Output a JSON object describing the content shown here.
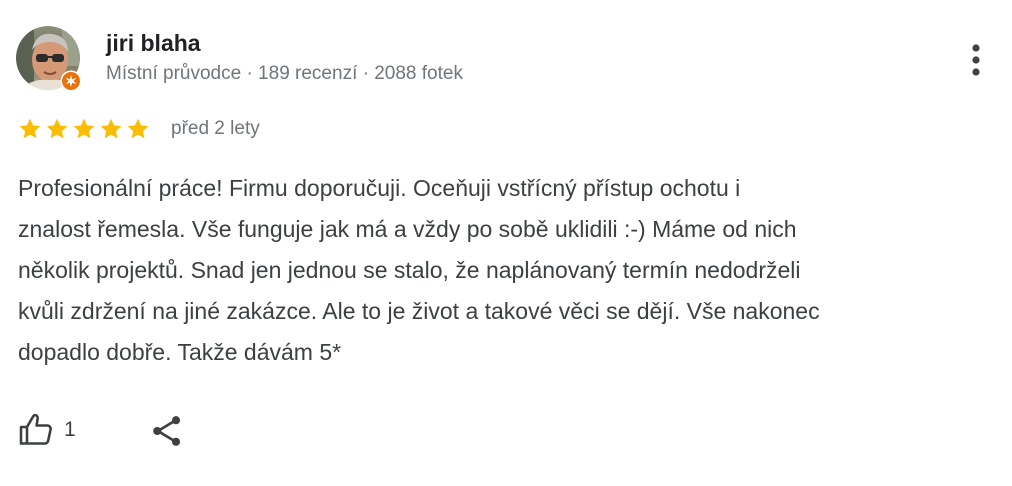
{
  "review": {
    "author": {
      "name": "jiri blaha",
      "meta": "Místní průvodce · 189 recenzí · 2088 fotek",
      "avatar_icon": "user-avatar",
      "badge_icon": "local-guide-badge-icon",
      "badge_color": "#e8710a"
    },
    "rating": {
      "stars": 5,
      "max": 5,
      "star_color": "#fbbc04"
    },
    "date": "před 2 lety",
    "text": "Profesionální práce! Firmu doporučuji. Oceňuji vstřícný přístup ochotu i\nznalost řemesla. Vše funguje jak má a vždy po sobě uklidili :-) Máme od nich\nněkolik projektů. Snad jen jednou se stalo, že naplánovaný termín nedodrželi\nkvůli zdržení na jiné zakázce. Ale to je život a takové věci se dějí. Vše nakonec\ndopadlo dobře. Takže dávám 5*",
    "actions": {
      "like_icon": "thumbs-up-icon",
      "like_count": "1",
      "share_icon": "share-icon",
      "more_icon": "more-vert-icon"
    }
  }
}
